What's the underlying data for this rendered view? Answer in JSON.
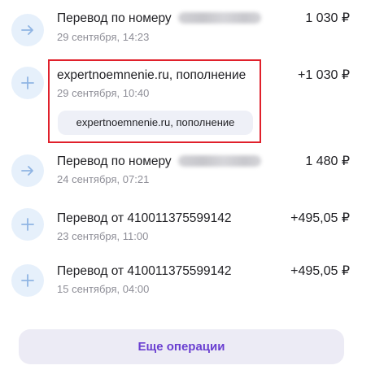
{
  "operations": [
    {
      "icon": "arrow-right-icon",
      "title": "Перевод по номеру",
      "date": "29 сентября, 14:23",
      "amount": "1 030 ₽"
    },
    {
      "icon": "plus-icon",
      "title": "expertnoemnenie.ru, пополнение",
      "date": "29 сентября, 10:40",
      "amount": "+1 030 ₽",
      "tag": "expertnoemnenie.ru, пополнение"
    },
    {
      "icon": "arrow-right-icon",
      "title": "Перевод по номеру",
      "date": "24 сентября, 07:21",
      "amount": "1 480 ₽"
    },
    {
      "icon": "plus-icon",
      "title": "Перевод от 410011375599142",
      "date": "23 сентября, 11:00",
      "amount": "+495,05 ₽"
    },
    {
      "icon": "plus-icon",
      "title": "Перевод от 410011375599142",
      "date": "15 сентября, 04:00",
      "amount": "+495,05 ₽"
    }
  ],
  "more_button": {
    "label": "Еще операции"
  },
  "colors": {
    "icon_bg": "#e6f0fb",
    "icon_fg": "#8fb4e3",
    "highlight": "#e0202b",
    "accent": "#6a3fd1",
    "button_bg": "#ecebf5"
  }
}
